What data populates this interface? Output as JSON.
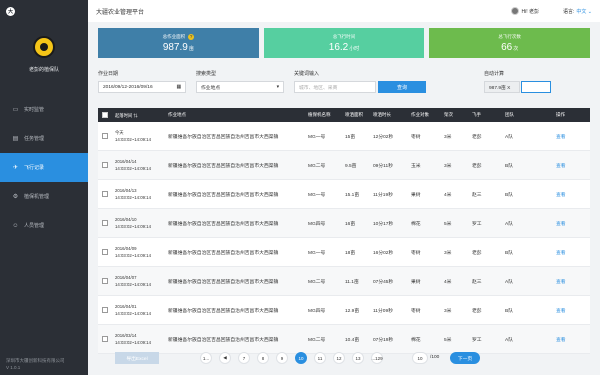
{
  "app": {
    "title": "大疆农业管理平台",
    "logo_glyph": "大"
  },
  "header": {
    "user": "Hi! 老彭",
    "lang_label": "语言:",
    "lang_value": "中文 ⌄"
  },
  "sidebar": {
    "team_name": "老彭的植保队",
    "items": [
      {
        "label": "实时监管",
        "icon": "monitor-icon",
        "glyph": "▭",
        "active": false
      },
      {
        "label": "任务管理",
        "icon": "tasks-icon",
        "glyph": "▤",
        "active": false
      },
      {
        "label": "飞行记录",
        "icon": "plane-icon",
        "glyph": "✈",
        "active": true
      },
      {
        "label": "植保机管理",
        "icon": "drone-icon",
        "glyph": "⚙",
        "active": false
      },
      {
        "label": "人员管理",
        "icon": "people-icon",
        "glyph": "☺",
        "active": false
      }
    ],
    "footer_line1": "深圳市大疆创新科技有限公司",
    "footer_line2": "V 1.0.1"
  },
  "stats": [
    {
      "label": "总作业面积",
      "value": "987.9",
      "unit": "亩",
      "color": "#3f7fa8",
      "has_help": true
    },
    {
      "label": "总飞行时间",
      "value": "16.2",
      "unit": "小时",
      "color": "#56cfa0",
      "has_help": false
    },
    {
      "label": "总飞行次数",
      "value": "66",
      "unit": "次",
      "color": "#6dbb4d",
      "has_help": false
    }
  ],
  "filters": {
    "date_label": "作业日期",
    "date_value": "2016/09/12-2016/09/16",
    "search_type_label": "搜索类型",
    "search_type_value": "作业地点",
    "keyword_label": "关键词输入",
    "keyword_placeholder": "城市、地区、采商",
    "query_button": "查询",
    "auto_calc_label": "自动计算",
    "auto_calc_value": "987.9亩 X"
  },
  "table": {
    "columns": [
      "起落时间",
      "作业地点",
      "植保机名称",
      "喷洒面积",
      "喷洒时长",
      "作业对象",
      "架次",
      "飞手",
      "团队",
      "操作"
    ],
    "rows": [
      {
        "date": "今天",
        "time": "14:03:02~14:09:14",
        "place": "新疆维吾尔族自治区吉昌回族自治州吉昌市大西渠镇",
        "device": "MG一号",
        "area": "15亩",
        "duration": "12分02秒",
        "object": "枣树",
        "count": "3米",
        "pilot": "老彭",
        "team": "A队",
        "op": "查看",
        "unread": true
      },
      {
        "date": "2016/04/14",
        "time": "14:03:02~14:09:14",
        "place": "新疆维吾尔族自治区吉昌回族自治州吉昌市大西渠镇",
        "device": "MG二号",
        "area": "9.5亩",
        "duration": "09分11秒",
        "object": "玉米",
        "count": "3米",
        "pilot": "老彭",
        "team": "B队",
        "op": "查看",
        "unread": false
      },
      {
        "date": "2016/04/13",
        "time": "14:03:02~14:09:14",
        "place": "新疆维吾尔族自治区吉昌回族自治州吉昌市大西渠镇",
        "device": "MG一号",
        "area": "15.1亩",
        "duration": "11分19秒",
        "object": "果树",
        "count": "4米",
        "pilot": "赵三",
        "team": "B队",
        "op": "查看",
        "unread": false
      },
      {
        "date": "2016/04/10",
        "time": "14:03:02~14:09:14",
        "place": "新疆维吾尔族自治区吉昌回族自治州吉昌市大西渠镇",
        "device": "MG四号",
        "area": "16亩",
        "duration": "10分17秒",
        "object": "棉花",
        "count": "5米",
        "pilot": "罗工",
        "team": "A队",
        "op": "查看",
        "unread": false
      },
      {
        "date": "2016/04/09",
        "time": "14:03:02~14:09:14",
        "place": "新疆维吾尔族自治区吉昌回族自治州吉昌市大西渠镇",
        "device": "MG一号",
        "area": "18亩",
        "duration": "16分02秒",
        "object": "枣树",
        "count": "3米",
        "pilot": "老彭",
        "team": "B队",
        "op": "查看",
        "unread": false
      },
      {
        "date": "2016/04/07",
        "time": "14:03:02~14:09:14",
        "place": "新疆维吾尔族自治区吉昌回族自治州吉昌市大西渠镇",
        "device": "MG二号",
        "area": "11.1亩",
        "duration": "07分45秒",
        "object": "果树",
        "count": "4米",
        "pilot": "赵三",
        "team": "A队",
        "op": "查看",
        "unread": false
      },
      {
        "date": "2016/04/01",
        "time": "14:03:02~14:09:14",
        "place": "新疆维吾尔族自治区吉昌回族自治州吉昌市大西渠镇",
        "device": "MG四号",
        "area": "12.9亩",
        "duration": "11分09秒",
        "object": "枣树",
        "count": "3米",
        "pilot": "老彭",
        "team": "B队",
        "op": "查看",
        "unread": false
      },
      {
        "date": "2016/03/14",
        "time": "14:03:02~14:09:14",
        "place": "新疆维吾尔族自治区吉昌回族自治州吉昌市大西渠镇",
        "device": "MG二号",
        "area": "10.4亩",
        "duration": "07分19秒",
        "object": "棉花",
        "count": "5米",
        "pilot": "罗工",
        "team": "A队",
        "op": "查看",
        "unread": false
      }
    ]
  },
  "bottom": {
    "export_button": "导出Excel",
    "pages": [
      "1...",
      "◀",
      "7",
      "8",
      "9",
      "10",
      "11",
      "12",
      "13",
      "...129"
    ],
    "active_page": "10",
    "page_input": "10",
    "page_total": "/100",
    "next_button": "下一页"
  }
}
